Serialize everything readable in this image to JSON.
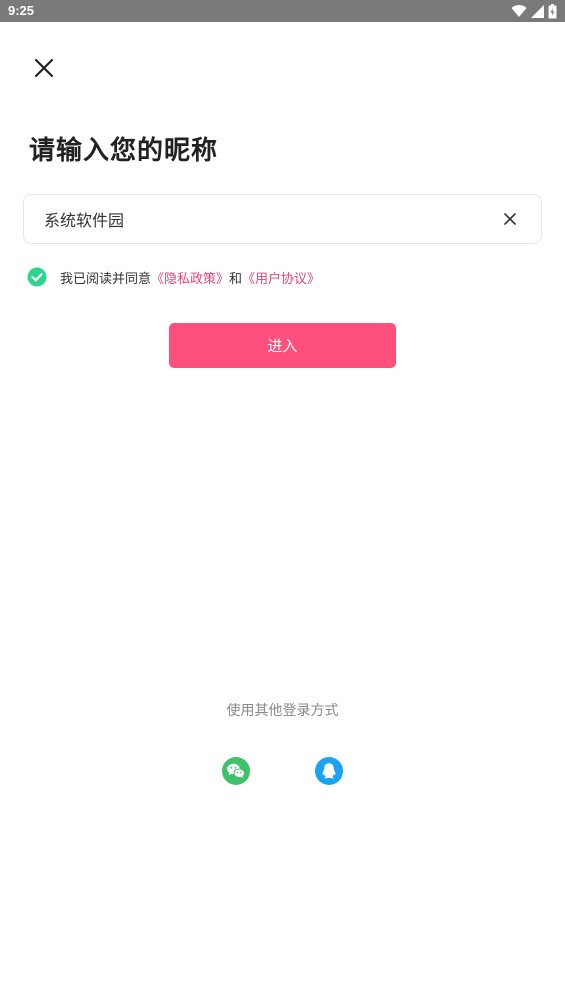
{
  "status_bar": {
    "time": "9:25"
  },
  "header": {
    "title": "请输入您的昵称"
  },
  "nickname": {
    "value": "系统软件园"
  },
  "agreement": {
    "prefix": "我已阅读并同意",
    "privacy_link": "《隐私政策》",
    "conjunction": "和",
    "terms_link": "《用户协议》",
    "checked": true
  },
  "enter_button": {
    "label": "进入"
  },
  "other_login": {
    "label": "使用其他登录方式",
    "options": [
      "wechat-icon",
      "qq-icon"
    ]
  },
  "colors": {
    "accent": "#ff4f7c",
    "link": "#e6457a",
    "check": "#2ed58f",
    "wechat": "#3ec26b",
    "qq": "#1aa3f0"
  }
}
